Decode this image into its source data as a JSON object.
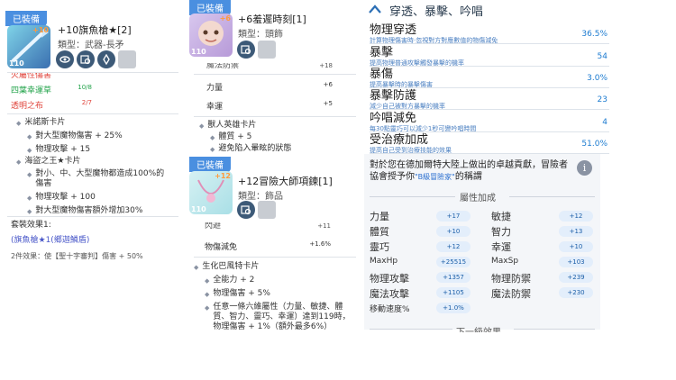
{
  "card1": {
    "badge": "已裝備",
    "name": "+10旗魚槍★[2]",
    "type": "類型：武器-長矛",
    "thumb_level": "110",
    "thumb_plus": "+10",
    "cut_row": "火屬性傷害",
    "rows": [
      {
        "label": "四葉幸運草",
        "value": "10/8",
        "color": "#22a34a"
      },
      {
        "label": "透明之布",
        "value": "2/7",
        "color": "#e0453c"
      }
    ],
    "cards": [
      {
        "title": "米諾斯卡片",
        "lines": [
          "對大型魔物傷害 + 25%",
          "物理攻擊 + 15"
        ]
      },
      {
        "title": "海盜之王★卡片",
        "lines": [
          "對小、中、大型魔物都造成100%的傷害",
          "物理攻擊 + 100",
          "對大型魔物傷害額外增加30%"
        ]
      }
    ],
    "set_title": "套裝效果1:",
    "set_link": "(旗魚槍★1(鄉迦鱗盾)",
    "set_effect": "2件效果：使【聖十字審判】傷害 + 50%"
  },
  "card2": {
    "badge": "已裝備",
    "name": "+6羞遲時刻[1]",
    "type": "類型：頭飾",
    "thumb_level": "110",
    "thumb_plus": "+6",
    "top_row": {
      "label": "魔法防禦",
      "value": "+18"
    },
    "rows": [
      {
        "label": "力量",
        "value": "+6"
      },
      {
        "label": "幸運",
        "value": "+5"
      }
    ],
    "card": {
      "title": "獸人英雄卡片",
      "lines": [
        "體質 + 5",
        "避免陷入暈眩的狀態"
      ]
    }
  },
  "card3": {
    "badge": "已裝備",
    "name": "+12冒險大師項鍊[1]",
    "type": "類型：飾品",
    "thumb_level": "110",
    "thumb_plus": "+12",
    "rows": [
      {
        "label": "閃避",
        "value": "+11"
      },
      {
        "label": "物傷減免",
        "value": "+1.6%"
      }
    ],
    "card": {
      "title": "生化巴風特卡片",
      "lines": [
        "全能力 + 2",
        "物理傷害 + 5%",
        "任意一條六維屬性（力量、敏捷、體質、智力、靈巧、幸運）達到119時，物理傷害 + 1%（額外最多6%）"
      ]
    }
  },
  "panel": {
    "title": "穿透、暴擊、吟唱",
    "stats": [
      {
        "name": "物理穿透",
        "desc": "計算物理傷害時·忽視對方對應數值的物傷減免",
        "value": "36.5%"
      },
      {
        "name": "暴擊",
        "desc": "提高物理普通攻擊觸發暴擊的機率",
        "value": "54"
      },
      {
        "name": "暴傷",
        "desc": "提高暴擊時的暴擊傷害",
        "value": "3.0%"
      },
      {
        "name": "暴擊防護",
        "desc": "減少自己被對方暴擊的機率",
        "value": "23"
      },
      {
        "name": "吟唱減免",
        "desc": "每30點靈巧可以減少1秒可變吟唱時間",
        "value": "4"
      },
      {
        "name": "受治療加成",
        "desc": "提高自己受到治療技能的效果",
        "value": "51.0%"
      }
    ],
    "honor_text": "對於您在德加爾特大陸上做出的卓越貢獻，冒險者協會授予你",
    "honor_title": "\"B級冒險家\"",
    "honor_suffix": "的稱謂",
    "attr_title": "屬性加成",
    "attrs_left": [
      {
        "label": "力量",
        "value": "+17"
      },
      {
        "label": "體質",
        "value": "+10"
      },
      {
        "label": "靈巧",
        "value": "+12"
      },
      {
        "label": "MaxHp",
        "value": "+25515"
      },
      {
        "label": "物理攻擊",
        "value": "+1357"
      },
      {
        "label": "魔法攻擊",
        "value": "+1105"
      },
      {
        "label": "移動速度%",
        "value": "+1.0%"
      }
    ],
    "attrs_right": [
      {
        "label": "敏捷",
        "value": "+12"
      },
      {
        "label": "智力",
        "value": "+13"
      },
      {
        "label": "幸運",
        "value": "+10"
      },
      {
        "label": "MaxSp",
        "value": "+103"
      },
      {
        "label": "物理防禦",
        "value": "+239"
      },
      {
        "label": "魔法防禦",
        "value": "+230"
      }
    ],
    "next_level": "下一級效果"
  }
}
